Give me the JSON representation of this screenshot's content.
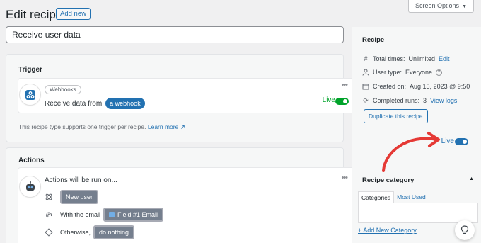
{
  "header": {
    "title": "Edit recipe",
    "add_new_label": "Add new",
    "screen_options_label": "Screen Options",
    "recipe_title_value": "Receive user data"
  },
  "trigger": {
    "section_title": "Trigger",
    "integration_tag": "Webhooks",
    "sentence_prefix": "Receive data from",
    "token": "a webhook",
    "menu_glyph": "•••",
    "live_label": "Live",
    "support_note": "This recipe type supports one trigger per recipe.",
    "learn_more": "Learn more"
  },
  "actions": {
    "section_title": "Actions",
    "intro": "Actions will be run on...",
    "menu_glyph": "•••",
    "row1_token": "New user",
    "row2_label": "With the email",
    "row2_token": "Field #1 Email",
    "row3_label": "Otherwise,",
    "row3_token": "do nothing"
  },
  "sidebar": {
    "recipe_box_title": "Recipe",
    "total_times_label": "Total times:",
    "total_times_value": "Unlimited",
    "total_times_link": "Edit",
    "user_type_label": "User type:",
    "user_type_value": "Everyone",
    "created_label": "Created on:",
    "created_value": "Aug 15, 2023 @ 9:50",
    "completed_label": "Completed runs:",
    "completed_value": "3",
    "completed_link": "View logs",
    "duplicate_label": "Duplicate this recipe",
    "live_label": "Live",
    "category_title": "Recipe category",
    "tab_categories": "Categories",
    "tab_most_used": "Most Used",
    "add_category_link": "+ Add New Category"
  },
  "colors": {
    "accent": "#2271b1",
    "live_green": "#00a32a",
    "annotation_red": "#e53935",
    "token_gray": "#757f8e"
  }
}
